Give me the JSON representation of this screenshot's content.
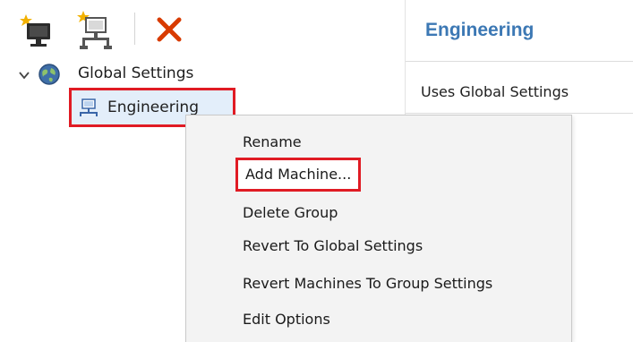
{
  "toolbar": {
    "icons": [
      "add-computer-icon",
      "add-network-group-icon",
      "delete-x-icon"
    ],
    "delete_color": "#d83b01"
  },
  "details": {
    "title": "Engineering",
    "subtitle": "Uses Global Settings",
    "title_color": "#3c78b4"
  },
  "tree": {
    "root_label": "Global Settings",
    "child_label": "Engineering"
  },
  "context_menu": {
    "items": [
      "Rename",
      "Add Machine...",
      "Delete Group",
      "Revert To Global Settings",
      "Revert Machines To Group Settings",
      "Edit Options"
    ],
    "highlight_color": "#e01b24"
  }
}
